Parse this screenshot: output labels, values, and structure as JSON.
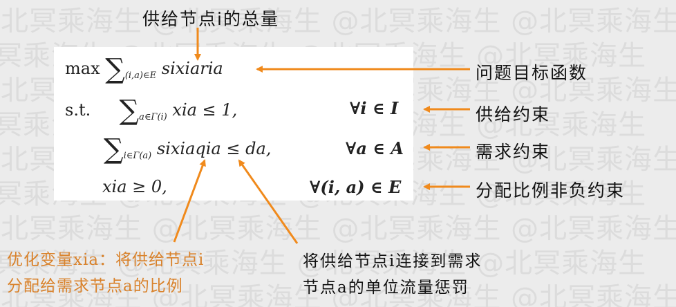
{
  "watermark": "@北冥乘海生",
  "top_label": "供给节点i的总量",
  "math": {
    "line1": {
      "max": "max",
      "sum": "∑",
      "sub": "(i,a)∈E",
      "expr": "sixiaria"
    },
    "line2": {
      "st": "s.t.",
      "sum": "∑",
      "sub": "a∈Γ(i)",
      "expr": "xia ≤ 1,",
      "forall": "∀i ∈ I"
    },
    "line3": {
      "sum": "∑",
      "sub": "i∈Γ(a)",
      "expr": "sixiaqia ≤ da,",
      "forall": "∀a ∈ A"
    },
    "line4": {
      "expr": "xia ≥ 0,",
      "forall": "∀(i, a) ∈ E"
    }
  },
  "right_labels": {
    "objective": "问题目标函数",
    "supply": "供给约束",
    "demand": "需求约束",
    "nonneg": "分配比例非负约束"
  },
  "bottom_left": {
    "line1": "优化变量xia：将供给节点i",
    "line2": "分配给需求节点a的比例"
  },
  "bottom_right": {
    "line1": "将供给节点i连接到需求",
    "line2": "节点a的单位流量惩罚"
  },
  "colors": {
    "arrow": "#f08a1c",
    "orange_text": "#d9822b"
  }
}
